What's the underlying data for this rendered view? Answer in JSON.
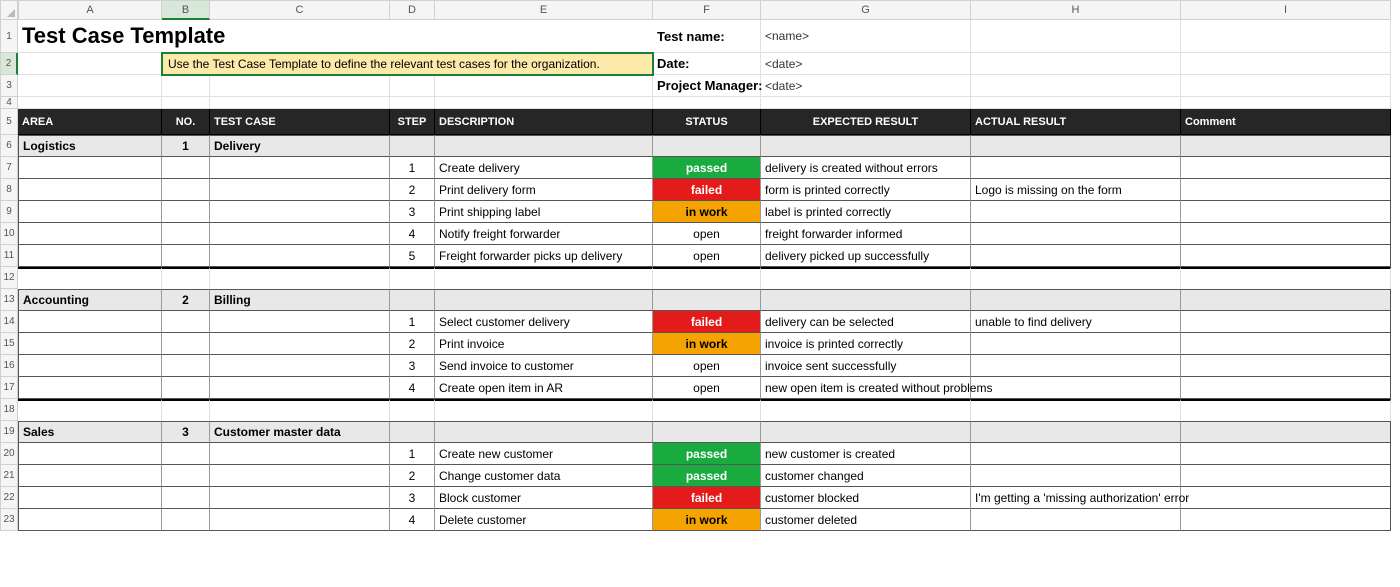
{
  "columns": [
    "A",
    "B",
    "C",
    "D",
    "E",
    "F",
    "G",
    "H",
    "I"
  ],
  "title": "Test Case Template",
  "note": "Use the Test Case Template to define the relevant test cases for the organization.",
  "meta": {
    "testNameLabel": "Test name:",
    "testNameValue": "<name>",
    "dateLabel": "Date:",
    "dateValue": "<date>",
    "pmLabel": "Project Manager:",
    "pmValue": "<date>"
  },
  "headers": {
    "area": "AREA",
    "no": "NO.",
    "testcase": "TEST CASE",
    "step": "STEP",
    "description": "DESCRIPTION",
    "status": "STATUS",
    "expected": "EXPECTED RESULT",
    "actual": "ACTUAL RESULT",
    "comment": "Comment"
  },
  "groups": [
    {
      "rowNum": 6,
      "area": "Logistics",
      "no": "1",
      "testcase": "Delivery",
      "steps": [
        {
          "rowNum": 7,
          "step": "1",
          "desc": "Create delivery",
          "status": "passed",
          "statusClass": "status-passed",
          "expected": "delivery is created without errors",
          "actual": "",
          "comment": ""
        },
        {
          "rowNum": 8,
          "step": "2",
          "desc": "Print delivery form",
          "status": "failed",
          "statusClass": "status-failed",
          "expected": "form is printed correctly",
          "actual": "Logo is missing on the form",
          "comment": ""
        },
        {
          "rowNum": 9,
          "step": "3",
          "desc": "Print shipping label",
          "status": "in work",
          "statusClass": "status-inwork",
          "expected": "label is printed correctly",
          "actual": "",
          "comment": ""
        },
        {
          "rowNum": 10,
          "step": "4",
          "desc": "Notify freight forwarder",
          "status": "open",
          "statusClass": "status-open",
          "expected": "freight forwarder informed",
          "actual": "",
          "comment": ""
        },
        {
          "rowNum": 11,
          "step": "5",
          "desc": "Freight forwarder picks up delivery",
          "status": "open",
          "statusClass": "status-open",
          "expected": "delivery picked up successfully",
          "actual": "",
          "comment": ""
        }
      ],
      "gapRow": 12
    },
    {
      "rowNum": 13,
      "area": "Accounting",
      "no": "2",
      "testcase": "Billing",
      "steps": [
        {
          "rowNum": 14,
          "step": "1",
          "desc": "Select customer delivery",
          "status": "failed",
          "statusClass": "status-failed",
          "expected": "delivery can be selected",
          "actual": "unable to find delivery",
          "comment": ""
        },
        {
          "rowNum": 15,
          "step": "2",
          "desc": "Print invoice",
          "status": "in work",
          "statusClass": "status-inwork",
          "expected": "invoice is printed correctly",
          "actual": "",
          "comment": ""
        },
        {
          "rowNum": 16,
          "step": "3",
          "desc": "Send invoice to customer",
          "status": "open",
          "statusClass": "status-open",
          "expected": "invoice sent successfully",
          "actual": "",
          "comment": ""
        },
        {
          "rowNum": 17,
          "step": "4",
          "desc": "Create open item in AR",
          "status": "open",
          "statusClass": "status-open",
          "expected": "new open item is created without problems",
          "actual": "",
          "comment": ""
        }
      ],
      "gapRow": 18
    },
    {
      "rowNum": 19,
      "area": "Sales",
      "no": "3",
      "testcase": "Customer master data",
      "steps": [
        {
          "rowNum": 20,
          "step": "1",
          "desc": "Create new customer",
          "status": "passed",
          "statusClass": "status-passed",
          "expected": "new customer is created",
          "actual": "",
          "comment": ""
        },
        {
          "rowNum": 21,
          "step": "2",
          "desc": "Change customer data",
          "status": "passed",
          "statusClass": "status-passed",
          "expected": "customer changed",
          "actual": "",
          "comment": ""
        },
        {
          "rowNum": 22,
          "step": "3",
          "desc": "Block customer",
          "status": "failed",
          "statusClass": "status-failed",
          "expected": "customer blocked",
          "actual": "I'm getting a 'missing authorization' error",
          "comment": ""
        },
        {
          "rowNum": 23,
          "step": "4",
          "desc": "Delete customer",
          "status": "in work",
          "statusClass": "status-inwork",
          "expected": "customer deleted",
          "actual": "",
          "comment": ""
        }
      ],
      "gapRow": null
    }
  ],
  "activeCell": {
    "row": 2,
    "col": "B"
  }
}
